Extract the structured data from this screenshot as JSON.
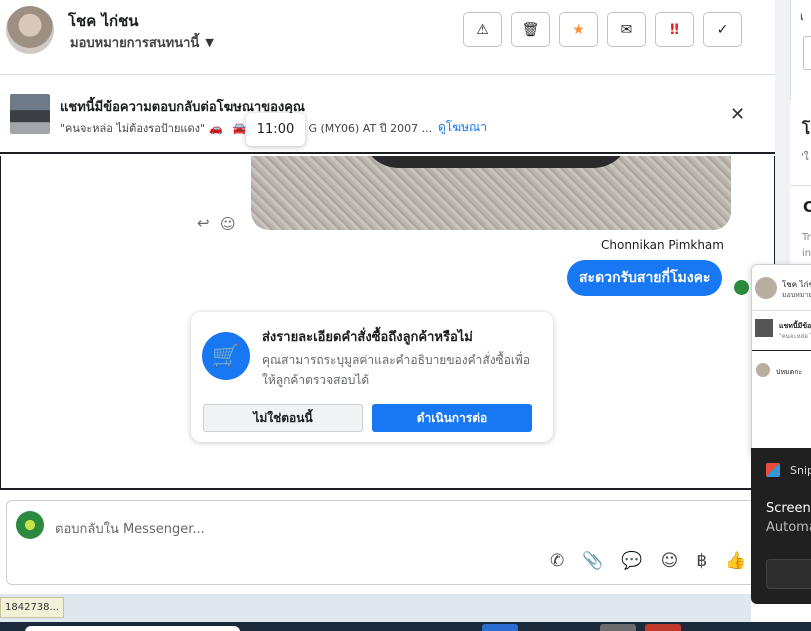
{
  "header": {
    "contact_name": "โชค ไก่ชน",
    "assign_label": "มอบหมายการสนทนานี้",
    "toolbar": [
      {
        "name": "mark-spam-button",
        "glyph": "⚠"
      },
      {
        "name": "delete-button",
        "glyph": "🗑"
      },
      {
        "name": "star-button",
        "glyph": "★"
      },
      {
        "name": "mark-unread-button",
        "glyph": "✉"
      },
      {
        "name": "follow-up-button",
        "glyph": "‼"
      },
      {
        "name": "mark-done-button",
        "glyph": "✓"
      }
    ]
  },
  "ad_banner": {
    "title": "แชทนี้มีข้อความตอบกลับต่อโฆษณาของคุณ",
    "quote": "\"คนจะหล่อ ไม่ต้องรอป้ายแดง\"",
    "car_emoji": "🚗",
    "car_emoji2": "🚘",
    "ad_title_fragment": "G (MY06) AT ปี 2007 ...",
    "view_ad_link": "ดูโฆษณา",
    "close_icon": "✕"
  },
  "tooltip_time": "11:00",
  "messages": {
    "sender_name": "Chonnikan Pimkham",
    "outgoing_text": "สะดวกรับสายกี่โมงคะ"
  },
  "order_card": {
    "title": "ส่งรายละเอียดคำสั่งซื้อถึงลูกค้าหรือไม่",
    "description": "คุณสามารถระบุมูลค่าและคำอธิบายของคำสั่งซื้อเพื่อให้ลูกค้าตรวจสอบได้",
    "decline_label": "ไม่ใช่ตอนนี้",
    "continue_label": "ดำเนินการต่อ",
    "cart_icon": "🛒"
  },
  "composer": {
    "placeholder": "ตอบกลับใน Messenger...",
    "icons": [
      {
        "name": "add-call-icon",
        "glyph": "✆"
      },
      {
        "name": "attach-icon",
        "glyph": "📎"
      },
      {
        "name": "saved-reply-icon",
        "glyph": "💬"
      },
      {
        "name": "emoji-icon",
        "glyph": "☺"
      },
      {
        "name": "baht-icon",
        "glyph": "฿"
      },
      {
        "name": "like-icon",
        "glyph": "👍"
      }
    ]
  },
  "right_panel": {
    "fragment_top": "เ",
    "fragment_heading": "โ",
    "fragment_sub": "'ใ",
    "fragment_heading2": "C",
    "fragment_line1": "Tr",
    "fragment_line2": "in"
  },
  "snip_preview": {
    "name": "โชค ไก่ชน",
    "assign": "มอบหมายก",
    "ad_title": "แชทนี้มีข้อ",
    "ad_quote": "\"คนจะหล่อ ไ",
    "msg": "ปหมดกะ"
  },
  "notification": {
    "app_name": "Snip",
    "line1": "Screens",
    "line2": "Automa"
  },
  "status_tip": "1842738..."
}
